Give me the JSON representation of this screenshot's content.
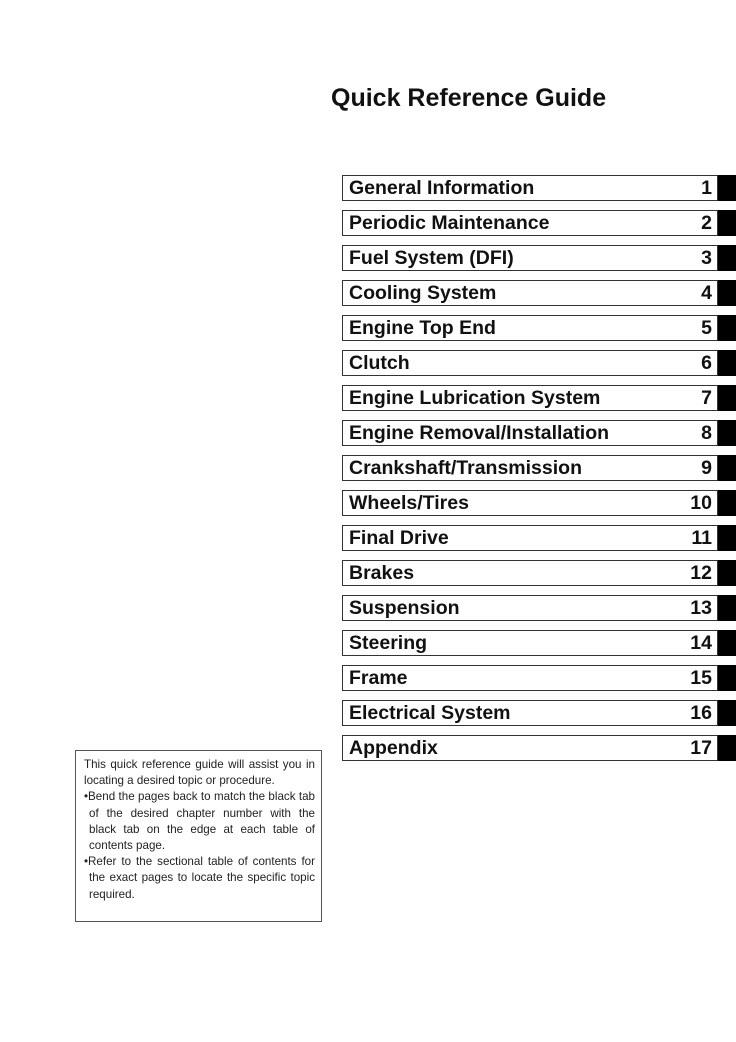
{
  "page": {
    "title": "Quick Reference Guide"
  },
  "toc": {
    "items": [
      {
        "label": "General Information",
        "number": "1"
      },
      {
        "label": "Periodic Maintenance",
        "number": "2"
      },
      {
        "label": "Fuel System (DFI)",
        "number": "3"
      },
      {
        "label": "Cooling System",
        "number": "4"
      },
      {
        "label": "Engine Top End",
        "number": "5"
      },
      {
        "label": "Clutch",
        "number": "6"
      },
      {
        "label": "Engine Lubrication System",
        "number": "7"
      },
      {
        "label": "Engine Removal/Installation",
        "number": "8"
      },
      {
        "label": "Crankshaft/Transmission",
        "number": "9"
      },
      {
        "label": "Wheels/Tires",
        "number": "10"
      },
      {
        "label": "Final Drive",
        "number": "11"
      },
      {
        "label": "Brakes",
        "number": "12"
      },
      {
        "label": "Suspension",
        "number": "13"
      },
      {
        "label": "Steering",
        "number": "14"
      },
      {
        "label": "Frame",
        "number": "15"
      },
      {
        "label": "Electrical System",
        "number": "16"
      },
      {
        "label": "Appendix",
        "number": "17"
      }
    ]
  },
  "note": {
    "intro": "This quick reference guide will assist you in locating a desired topic or procedure.",
    "bullets": [
      "•Bend the pages back to match the black tab of the desired chapter number with the black tab on the edge at each table of contents page.",
      "•Refer to the sectional table of contents for the exact pages to locate the specific topic required."
    ]
  }
}
